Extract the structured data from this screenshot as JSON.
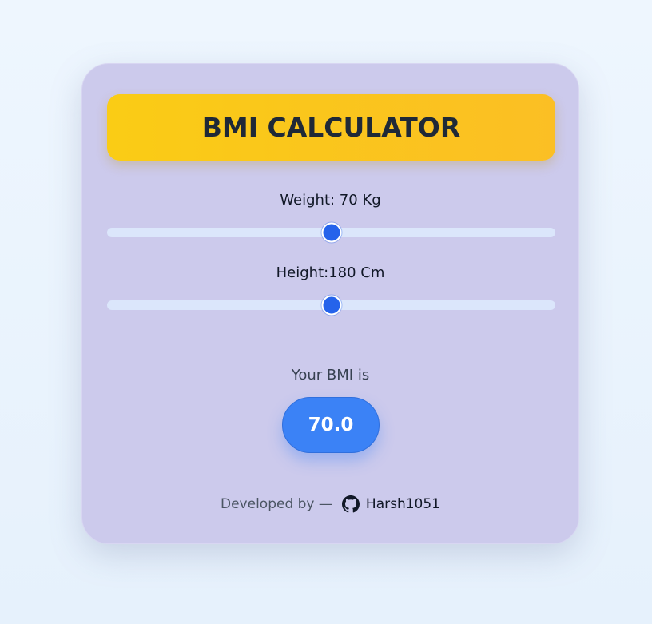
{
  "title": "BMI CALCULATOR",
  "weight": {
    "label": "Weight: 70 Kg",
    "value": 70,
    "fraction": 0.5
  },
  "height": {
    "label": "Height:180 Cm",
    "value": 180,
    "fraction": 0.5
  },
  "result": {
    "caption": "Your BMI is",
    "value": "70.0"
  },
  "footer": {
    "prefix": "Developed by —",
    "icon": "github-icon",
    "author": "Harsh1051"
  },
  "colors": {
    "card": "#cccaec",
    "title_bg": "#facc15",
    "accent": "#2563eb",
    "bmi_pill": "#3b82f6",
    "track": "#dbe6fb"
  }
}
